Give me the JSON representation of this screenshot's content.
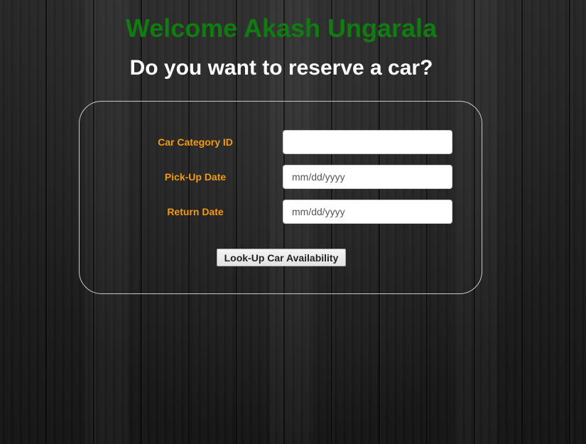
{
  "header": {
    "welcome": "Welcome Akash Ungarala",
    "question": "Do you want to reserve a car?"
  },
  "form": {
    "fields": [
      {
        "label": "Car Category ID",
        "value": "",
        "placeholder": ""
      },
      {
        "label": "Pick-Up Date",
        "value": "",
        "placeholder": "mm/dd/yyyy"
      },
      {
        "label": "Return Date",
        "value": "",
        "placeholder": "mm/dd/yyyy"
      }
    ],
    "submit_label": "Look-Up Car Availability"
  },
  "colors": {
    "welcome": "#107c10",
    "label": "#f39a10",
    "question": "#ffffff"
  }
}
